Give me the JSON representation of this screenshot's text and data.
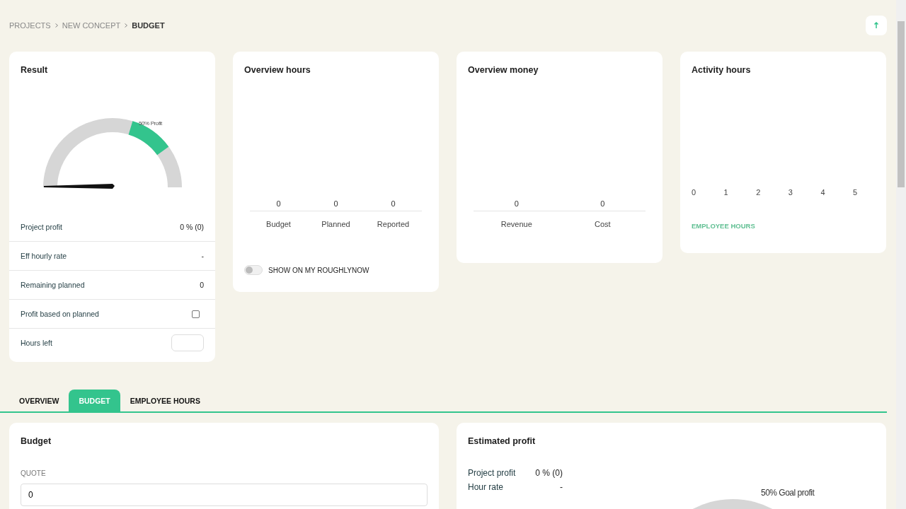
{
  "breadcrumb": [
    {
      "label": "PROJECTS",
      "current": false
    },
    {
      "label": "NEW CONCEPT",
      "current": false
    },
    {
      "label": "BUDGET",
      "current": true
    }
  ],
  "result": {
    "title": "Result",
    "gauge_label": "50% Profit",
    "rows": [
      {
        "kind": "text",
        "label": "Project profit",
        "value": "0 % (0)"
      },
      {
        "kind": "text",
        "label": "Eff hourly rate",
        "value": "-"
      },
      {
        "kind": "text",
        "label": "Remaining planned",
        "value": "0"
      },
      {
        "kind": "checkbox",
        "label": "Profit based on planned",
        "checked": false
      },
      {
        "kind": "input",
        "label": "Hours left"
      }
    ]
  },
  "overview_hours": {
    "title": "Overview hours",
    "items": [
      {
        "label": "Budget",
        "value": "0"
      },
      {
        "label": "Planned",
        "value": "0"
      },
      {
        "label": "Reported",
        "value": "0"
      }
    ],
    "toggle": {
      "label": "SHOW ON MY ROUGHLYNOW",
      "on": false
    }
  },
  "overview_money": {
    "title": "Overview money",
    "items": [
      {
        "label": "Revenue",
        "value": "0"
      },
      {
        "label": "Cost",
        "value": "0"
      }
    ]
  },
  "activity_hours": {
    "title": "Activity hours",
    "ticks": [
      "0",
      "1",
      "2",
      "3",
      "4",
      "5"
    ],
    "link": "EMPLOYEE HOURS"
  },
  "tabs": [
    {
      "label": "OVERVIEW",
      "selected": false
    },
    {
      "label": "BUDGET",
      "selected": true
    },
    {
      "label": "EMPLOYEE HOURS",
      "selected": false
    }
  ],
  "budget": {
    "title": "Budget",
    "field_label": "QUOTE",
    "field_value": "0"
  },
  "estimated_profit": {
    "title": "Estimated profit",
    "rows": [
      {
        "label": "Project profit",
        "value": "0 % (0)"
      },
      {
        "label": "Hour rate",
        "value": "-"
      }
    ],
    "gauge_label": "50% Goal profit"
  }
}
